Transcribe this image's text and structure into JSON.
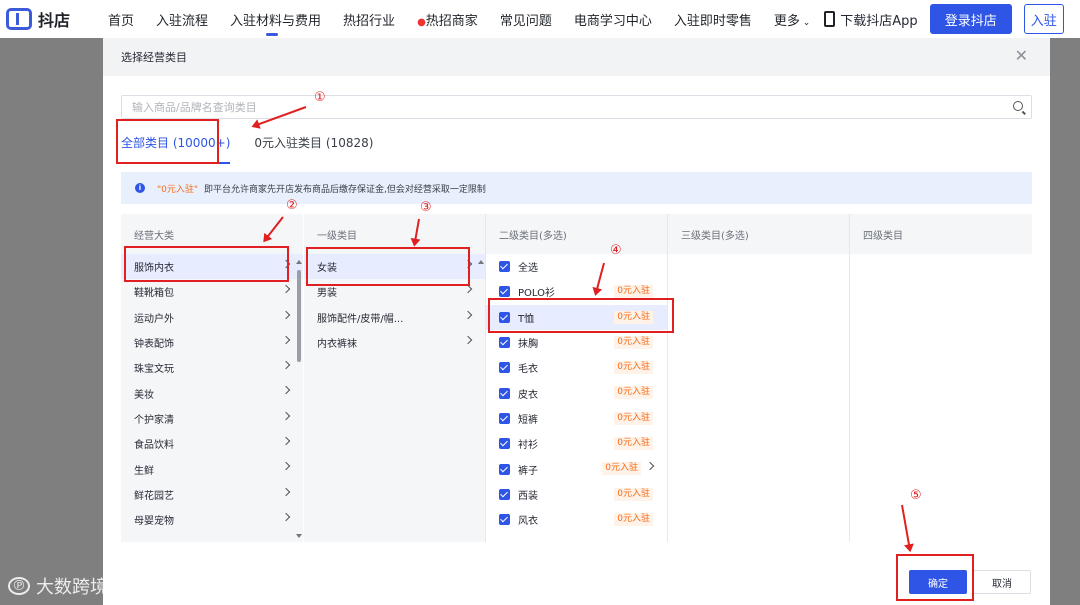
{
  "nav": {
    "logo": "抖店",
    "items": [
      "首页",
      "入驻流程",
      "入驻材料与费用",
      "热招行业",
      "热招商家",
      "常见问题",
      "电商学习中心",
      "入驻即时零售",
      "更多"
    ],
    "download": "下载抖店App",
    "login": "登录抖店",
    "settle": "入驻"
  },
  "modal": {
    "title": "选择经营类目",
    "search_placeholder": "输入商品/品牌名查询类目",
    "tabs": [
      "全部类目 (10000+)",
      "0元入驻类目 (10828)"
    ],
    "notice_highlight": "\"0元入驻\"",
    "notice_text": "即平台允许商家先开店发布商品后缴存保证金,但会对经营采取一定限制",
    "columns": [
      "经营大类",
      "一级类目",
      "二级类目(多选)",
      "三级类目(多选)",
      "四级类目"
    ],
    "major": [
      "服饰内衣",
      "鞋靴箱包",
      "运动户外",
      "钟表配饰",
      "珠宝文玩",
      "美妆",
      "个护家清",
      "食品饮料",
      "生鲜",
      "鲜花园艺",
      "母婴宠物"
    ],
    "level1": [
      "女装",
      "男装",
      "服饰配件/皮带/帽...",
      "内衣裤袜"
    ],
    "level2": [
      {
        "label": "全选",
        "badge": ""
      },
      {
        "label": "POLO衫",
        "badge": "0元入驻"
      },
      {
        "label": "T恤",
        "badge": "0元入驻"
      },
      {
        "label": "抹胸",
        "badge": "0元入驻"
      },
      {
        "label": "毛衣",
        "badge": "0元入驻"
      },
      {
        "label": "皮衣",
        "badge": "0元入驻"
      },
      {
        "label": "短裤",
        "badge": "0元入驻"
      },
      {
        "label": "衬衫",
        "badge": "0元入驻"
      },
      {
        "label": "裤子",
        "badge": "0元入驻"
      },
      {
        "label": "西装",
        "badge": "0元入驻"
      },
      {
        "label": "风衣",
        "badge": "0元入驻"
      }
    ],
    "confirm": "确定",
    "cancel": "取消"
  },
  "annotations": [
    "①",
    "②",
    "③",
    "④",
    "⑤"
  ],
  "watermark": "大数跨境",
  "colors": {
    "brand": "#2e55e6",
    "annotation": "#e02020",
    "badge": "#f76b15"
  }
}
